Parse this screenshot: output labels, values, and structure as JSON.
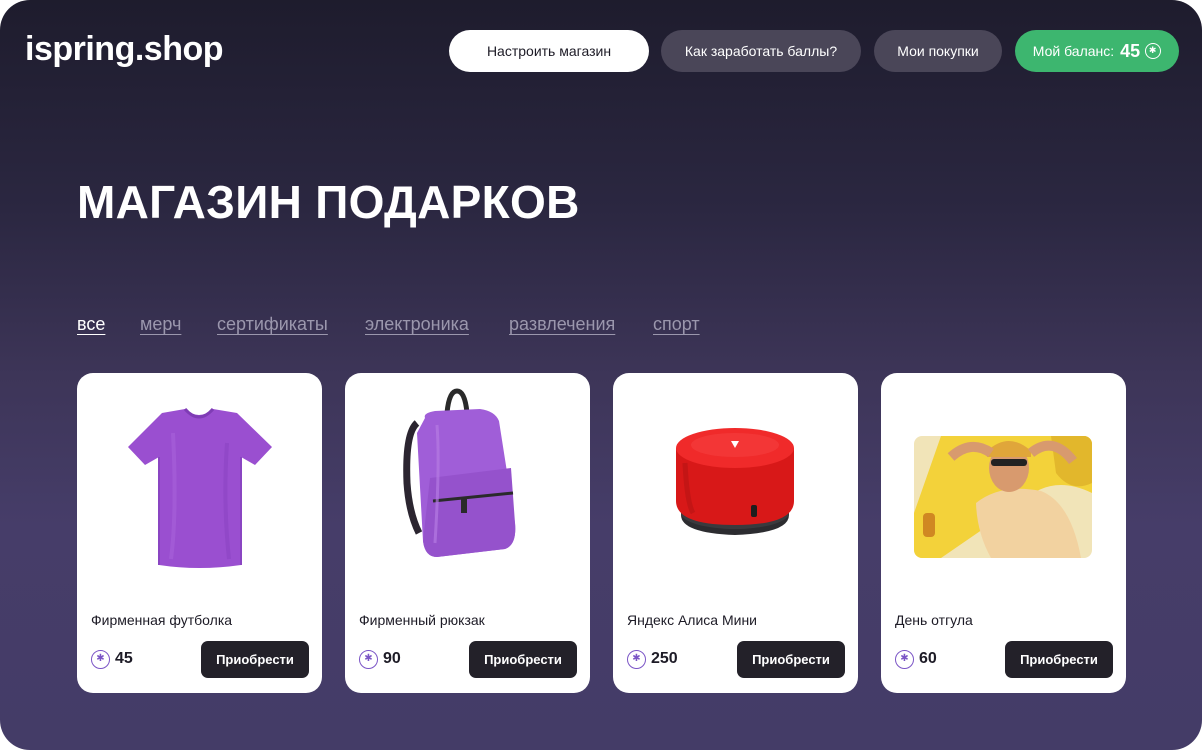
{
  "header": {
    "logo": "ispring.shop",
    "nav": {
      "setup_label": "Настроить магазин",
      "earn_label": "Как заработать баллы?",
      "purchases_label": "Мои покупки",
      "balance_label": "Мой баланс:",
      "balance_value": "45",
      "balance_icon": "points-coin-icon"
    }
  },
  "main": {
    "title": "МАГАЗИН ПОДАРКОВ",
    "categories": [
      {
        "label": "все",
        "active": true
      },
      {
        "label": "мерч",
        "active": false
      },
      {
        "label": "сертификаты",
        "active": false
      },
      {
        "label": "электроника",
        "active": false
      },
      {
        "label": "развлечения",
        "active": false
      },
      {
        "label": "спорт",
        "active": false
      }
    ],
    "products": [
      {
        "name": "Фирменная футболка",
        "price": "45",
        "buy_label": "Приобрести",
        "image": "purple-tshirt"
      },
      {
        "name": "Фирменный рюкзак",
        "price": "90",
        "buy_label": "Приобрести",
        "image": "purple-backpack"
      },
      {
        "name": "Яндекс Алиса Мини",
        "price": "250",
        "buy_label": "Приобрести",
        "image": "red-smart-speaker"
      },
      {
        "name": "День отгула",
        "price": "60",
        "buy_label": "Приобрести",
        "image": "man-relaxing-photo"
      }
    ]
  },
  "colors": {
    "accent_green": "#3db66f",
    "coin_purple": "#7b55c6",
    "product_purple": "#9a4fd0",
    "speaker_red": "#e51d1d"
  }
}
